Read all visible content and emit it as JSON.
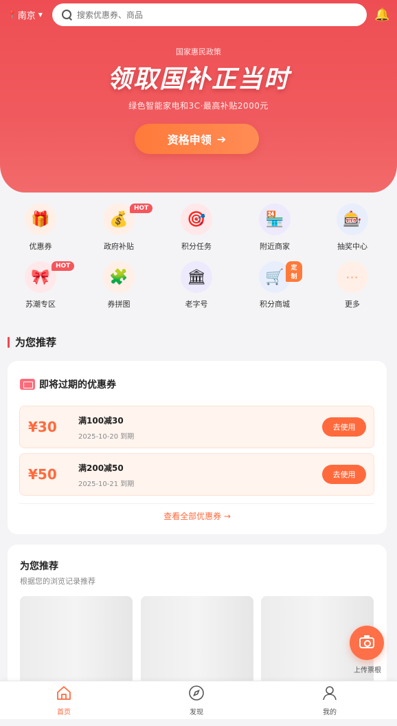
{
  "topbar": {
    "city": "南京",
    "search_placeholder": "搜索优惠券、商品"
  },
  "hero": {
    "subtitle": "国家惠民政策",
    "title": "领取国补正当时",
    "desc": "绿色智能家电和3C·最高补贴2000元",
    "button": "资格申领"
  },
  "grid": [
    {
      "label": "优惠券",
      "icon": "gift-icon",
      "glyph": "🎁",
      "bg": "#ffefe6",
      "tag": ""
    },
    {
      "label": "政府补贴",
      "icon": "money-bag-icon",
      "glyph": "💰",
      "bg": "#ffefe6",
      "tag": "HOT"
    },
    {
      "label": "积分任务",
      "icon": "target-icon",
      "glyph": "🎯",
      "bg": "#ffe8ea",
      "tag": ""
    },
    {
      "label": "附近商家",
      "icon": "store-icon",
      "glyph": "🏪",
      "bg": "#eceafc",
      "tag": ""
    },
    {
      "label": "抽奖中心",
      "icon": "slot-machine-icon",
      "glyph": "🎰",
      "bg": "#e8eefc",
      "tag": ""
    },
    {
      "label": "苏潮专区",
      "icon": "ribbon-icon",
      "glyph": "🎀",
      "bg": "#ffe8ea",
      "tag": "HOT"
    },
    {
      "label": "券拼图",
      "icon": "puzzle-icon",
      "glyph": "🧩",
      "bg": "#ffefe6",
      "tag": ""
    },
    {
      "label": "老字号",
      "icon": "classical-building-icon",
      "glyph": "🏛",
      "bg": "#eceafc",
      "tag": ""
    },
    {
      "label": "积分商城",
      "icon": "shopping-cart-icon",
      "glyph": "🛒",
      "bg": "#e8eefc",
      "tag": "定制"
    },
    {
      "label": "更多",
      "icon": "more-dots-icon",
      "glyph": "···",
      "bg": "#ffefe6",
      "tag": ""
    }
  ],
  "section_title": "为您推荐",
  "expiring": {
    "title": "即将过期的优惠券",
    "coupons": [
      {
        "price": "¥30",
        "name": "满100减30",
        "date": "2025-10-20 到期",
        "button": "去使用"
      },
      {
        "price": "¥50",
        "name": "满200减50",
        "date": "2025-10-21 到期",
        "button": "去使用"
      }
    ],
    "view_all": "查看全部优惠券 →"
  },
  "recommend": {
    "title": "为您推荐",
    "subtitle": "根据您的浏览记录推荐"
  },
  "fab_label": "上传票根",
  "tabs": [
    {
      "label": "首页",
      "icon": "home-icon",
      "active": true
    },
    {
      "label": "发现",
      "icon": "compass-icon",
      "active": false
    },
    {
      "label": "我的",
      "icon": "user-icon",
      "active": false
    }
  ],
  "colors": {
    "hero": "#ee4e53",
    "accent": "#ff6a3d",
    "hot_tag": "#f5565b"
  }
}
